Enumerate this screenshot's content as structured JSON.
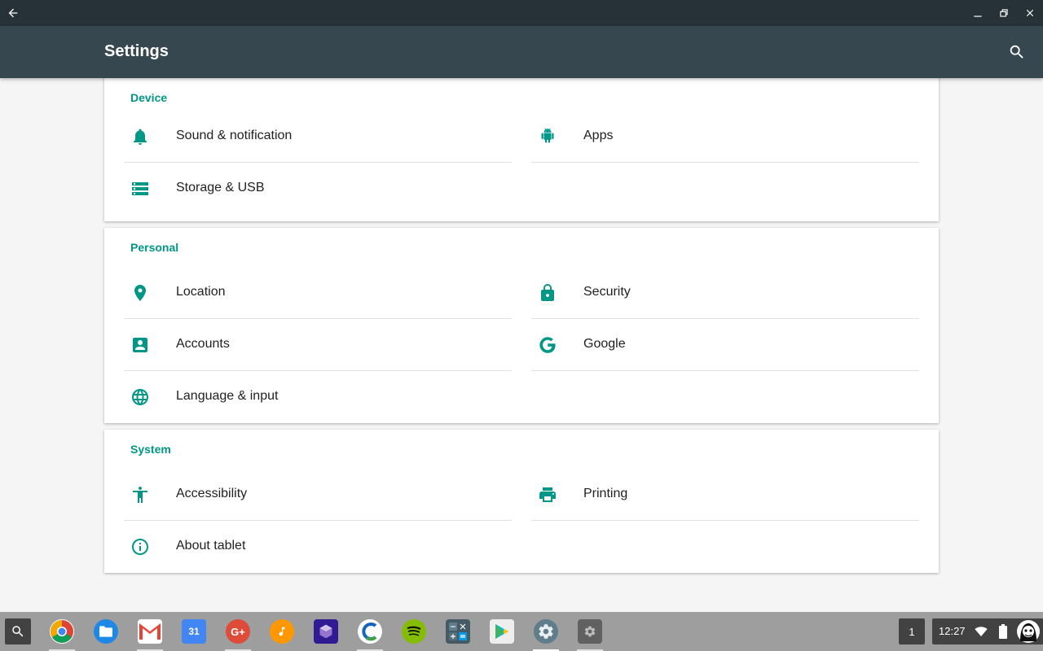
{
  "window": {
    "back_icon": "arrow-back-icon",
    "minimize_icon": "minimize-icon",
    "maximize_icon": "restore-icon",
    "close_icon": "close-icon"
  },
  "appbar": {
    "title": "Settings",
    "search_icon": "search-icon"
  },
  "sections": [
    {
      "title": "Device",
      "items": [
        {
          "label": "Sound & notification",
          "icon": "bell-icon"
        },
        {
          "label": "Apps",
          "icon": "android-icon"
        },
        {
          "label": "Storage & USB",
          "icon": "storage-icon"
        }
      ]
    },
    {
      "title": "Personal",
      "items": [
        {
          "label": "Location",
          "icon": "location-pin-icon"
        },
        {
          "label": "Security",
          "icon": "lock-icon"
        },
        {
          "label": "Accounts",
          "icon": "account-box-icon"
        },
        {
          "label": "Google",
          "icon": "google-g-icon"
        },
        {
          "label": "Language & input",
          "icon": "globe-icon"
        }
      ]
    },
    {
      "title": "System",
      "items": [
        {
          "label": "Accessibility",
          "icon": "accessibility-icon"
        },
        {
          "label": "Printing",
          "icon": "printer-icon"
        },
        {
          "label": "About tablet",
          "icon": "info-icon"
        }
      ]
    }
  ],
  "shelf": {
    "apps": [
      {
        "name": "chrome",
        "color": "#4285f4"
      },
      {
        "name": "files",
        "color": "#1e88e5"
      },
      {
        "name": "gmail",
        "color": "#ea4335"
      },
      {
        "name": "calendar",
        "color": "#4285f4",
        "text": "31"
      },
      {
        "name": "google-plus",
        "color": "#dd4b39"
      },
      {
        "name": "play-music",
        "color": "#ff9800"
      },
      {
        "name": "app-cube",
        "color": "#5e35b1"
      },
      {
        "name": "app-s",
        "color": "#1565c0"
      },
      {
        "name": "spotify",
        "color": "#84bd00"
      },
      {
        "name": "calculator",
        "color": "#455a64"
      },
      {
        "name": "play-store",
        "color": "#eeeeee"
      },
      {
        "name": "settings-app",
        "color": "#607d8b"
      },
      {
        "name": "settings-gear",
        "color": "#616161"
      }
    ],
    "workspace_count": "1",
    "time": "12:27",
    "accent": "#009688"
  }
}
